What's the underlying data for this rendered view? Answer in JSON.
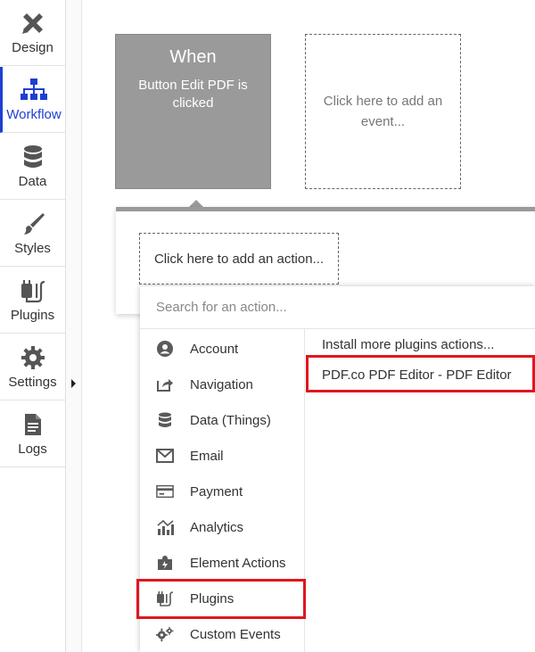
{
  "sidebar": {
    "items": [
      {
        "label": "Design",
        "icon": "design-icon"
      },
      {
        "label": "Workflow",
        "icon": "workflow-icon",
        "active": true
      },
      {
        "label": "Data",
        "icon": "database-icon"
      },
      {
        "label": "Styles",
        "icon": "brush-icon"
      },
      {
        "label": "Plugins",
        "icon": "plug-icon"
      },
      {
        "label": "Settings",
        "icon": "gear-icon"
      },
      {
        "label": "Logs",
        "icon": "document-icon"
      }
    ]
  },
  "event_card": {
    "title": "When",
    "description": "Button Edit PDF is clicked"
  },
  "add_event_label": "Click here to add an event...",
  "add_action_label": "Click here to add an action...",
  "action_menu": {
    "search_placeholder": "Search for an action...",
    "categories": [
      {
        "label": "Account",
        "icon": "account-icon"
      },
      {
        "label": "Navigation",
        "icon": "navigation-icon"
      },
      {
        "label": "Data (Things)",
        "icon": "database-icon"
      },
      {
        "label": "Email",
        "icon": "email-icon"
      },
      {
        "label": "Payment",
        "icon": "credit-card-icon"
      },
      {
        "label": "Analytics",
        "icon": "analytics-icon"
      },
      {
        "label": "Element Actions",
        "icon": "puzzle-icon"
      },
      {
        "label": "Plugins",
        "icon": "plug-icon",
        "highlighted": true
      },
      {
        "label": "Custom Events",
        "icon": "gears-icon"
      }
    ],
    "plugin_items": [
      {
        "label": "Install more plugins actions..."
      },
      {
        "label": "PDF.co PDF Editor - PDF Editor",
        "highlighted": true
      }
    ]
  },
  "colors": {
    "accent": "#1d3fd1",
    "highlight": "#e0161f",
    "event_card_bg": "#9a9a9a",
    "icon_gray": "#5a5a5a"
  }
}
